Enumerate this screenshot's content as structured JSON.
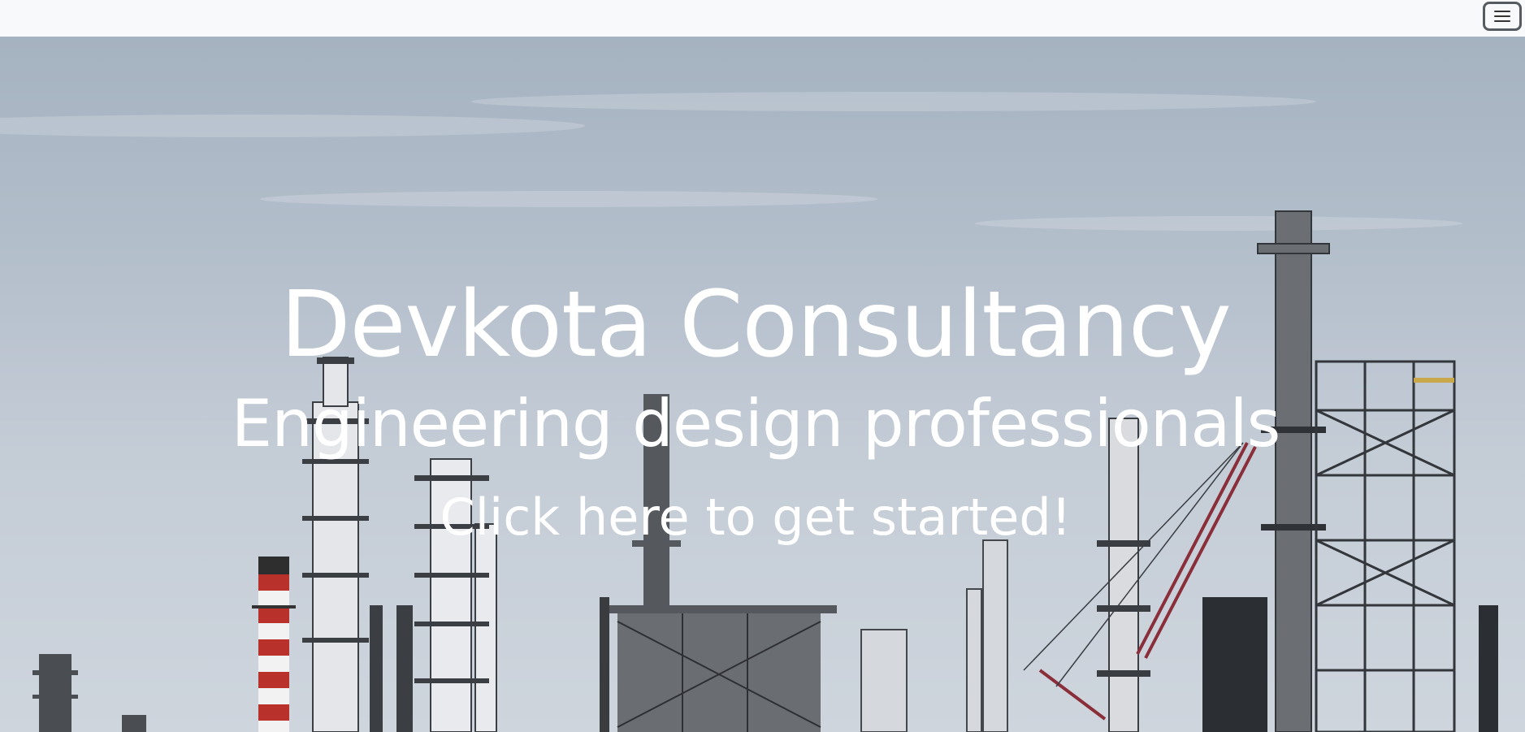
{
  "navbar": {
    "menu_toggle_icon": "hamburger-menu-icon"
  },
  "hero": {
    "title": "Devkota Consultancy",
    "subtitle": "Engineering design professionals",
    "cta_label": "Click here to get started!",
    "background": "industrial-refinery-skyline-photo"
  },
  "colors": {
    "navbar_bg": "#f8f9fa",
    "hero_text": "#ffffff"
  }
}
